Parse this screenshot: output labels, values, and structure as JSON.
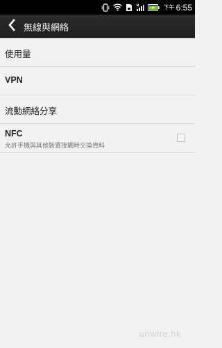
{
  "status_bar": {
    "ampm": "下午",
    "time": "6:55",
    "icons": [
      "vibrate-icon",
      "wifi-icon",
      "sd-card-icon",
      "signal-icon",
      "battery-charging-icon"
    ]
  },
  "action_bar": {
    "title": "無線與網絡",
    "back_icon": "chevron-left-icon"
  },
  "settings": {
    "items": [
      {
        "label": "使用量"
      },
      {
        "label": "VPN"
      },
      {
        "label": "流動網絡分享"
      },
      {
        "label": "NFC",
        "subtitle": "允許手機與其他裝置接觸時交換資料",
        "checked": false
      }
    ]
  },
  "watermark": "unwire.hk"
}
